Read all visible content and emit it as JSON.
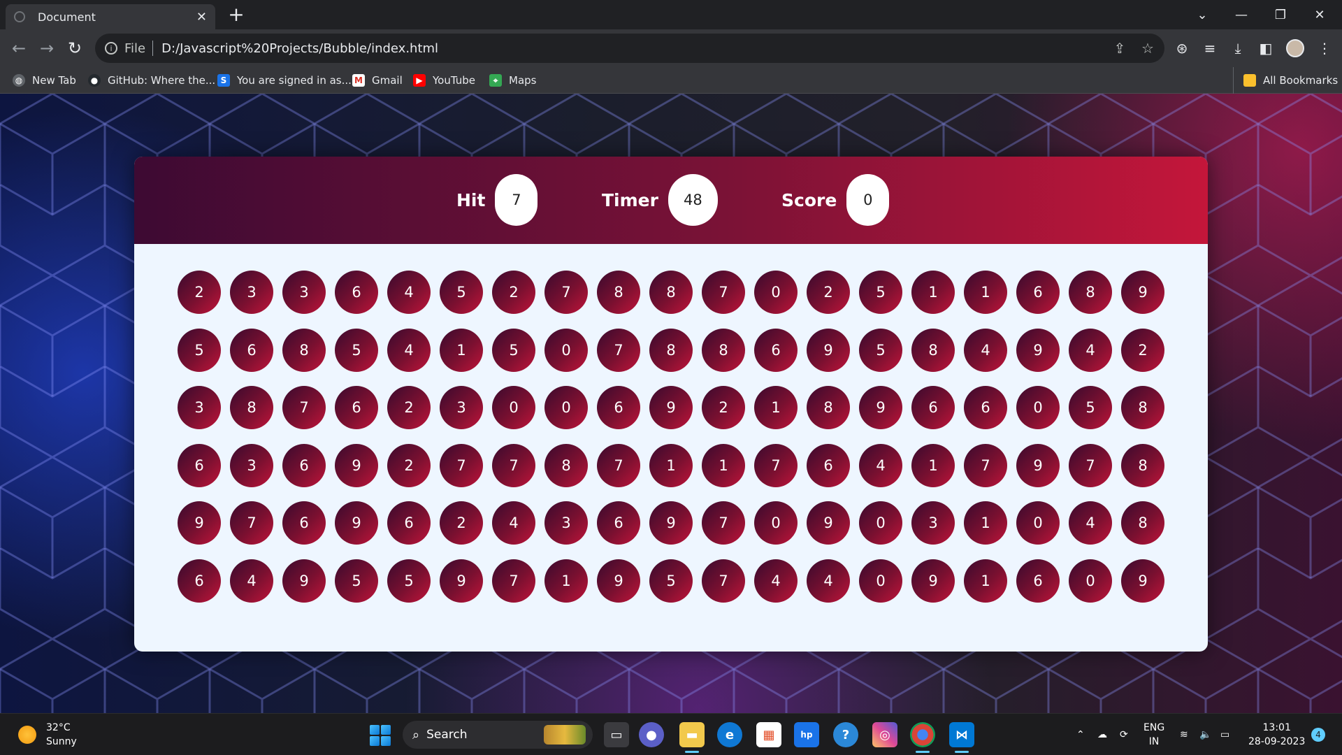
{
  "browser": {
    "tab_title": "Document",
    "tab_close": "✕",
    "new_tab": "+",
    "scheme": "File",
    "address": "D:/Javascript%20Projects/Bubble/index.html",
    "bookmarks": [
      {
        "label": "New Tab",
        "icon": "globe-icon",
        "color": "#5f6368"
      },
      {
        "label": "GitHub: Where the...",
        "icon": "github-icon",
        "color": "#24292e"
      },
      {
        "label": "You are signed in as...",
        "icon": "s-brand-icon",
        "color": "#1a73e8"
      },
      {
        "label": "Gmail",
        "icon": "gmail-icon",
        "color": "#d93025"
      },
      {
        "label": "YouTube",
        "icon": "youtube-icon",
        "color": "#ff0000"
      },
      {
        "label": "Maps",
        "icon": "maps-icon",
        "color": "#34a853"
      }
    ],
    "all_bookmarks": "All Bookmarks"
  },
  "game": {
    "hit_label": "Hit",
    "hit_value": "7",
    "timer_label": "Timer",
    "timer_value": "48",
    "score_label": "Score",
    "score_value": "0",
    "colors": {
      "top_start": "#3d0a33",
      "top_end": "#c4163a",
      "board_bg": "#eef6ff"
    },
    "bubbles": [
      [
        2,
        3,
        3,
        6,
        4,
        5,
        2,
        7,
        8,
        8,
        7,
        0,
        2,
        5,
        1,
        1,
        6,
        8,
        9
      ],
      [
        5,
        6,
        8,
        5,
        4,
        1,
        5,
        0,
        7,
        8,
        8,
        6,
        9,
        5,
        8,
        4,
        9,
        4,
        2
      ],
      [
        3,
        8,
        7,
        6,
        2,
        3,
        0,
        0,
        6,
        9,
        2,
        1,
        8,
        9,
        6,
        6,
        0,
        5,
        8
      ],
      [
        6,
        3,
        6,
        9,
        2,
        7,
        7,
        8,
        7,
        1,
        1,
        7,
        6,
        4,
        1,
        7,
        9,
        7,
        8
      ],
      [
        9,
        7,
        6,
        9,
        6,
        2,
        4,
        3,
        6,
        9,
        7,
        0,
        9,
        0,
        3,
        1,
        0,
        4,
        8
      ],
      [
        6,
        4,
        9,
        5,
        5,
        9,
        7,
        1,
        9,
        5,
        7,
        4,
        4,
        0,
        9,
        1,
        6,
        0,
        9
      ]
    ]
  },
  "taskbar": {
    "temperature": "32°C",
    "condition": "Sunny",
    "search_label": "Search",
    "lang_top": "ENG",
    "lang_bottom": "IN",
    "time": "13:01",
    "date": "28-09-2023",
    "notifications": "4"
  }
}
